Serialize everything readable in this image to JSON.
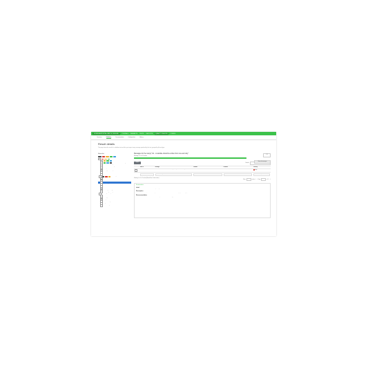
{
  "nav": {
    "brand": "OPENDATAPORTAL-WATCH / ENGINE",
    "items": [
      "PORTALS",
      "DATASETS",
      "TESTS",
      "REPORTS",
      "QUALITY CHECKS",
      "CONFIG"
    ]
  },
  "tabs": [
    "Overview",
    "Validation",
    "Documentation",
    "Configuration",
    "History"
  ],
  "page": {
    "title": "Result details",
    "description": "This page shows the result of a validation test and lets you inspect every message produced by the test, grouped by file and type."
  },
  "left": {
    "title": "Show list"
  },
  "tree": [
    {
      "label": "00 Validation"
    },
    {
      "label": "01 Dataset structure"
    },
    {
      "label": "02 File A - columns missing"
    },
    {
      "label": "03 File B - encoding error"
    },
    {
      "label": "04 Values outside range"
    },
    {
      "label": "05 Duplicated identifiers"
    },
    {
      "label": "06 Empty mandatory fields"
    },
    {
      "label": "07 Dates not ISO formatted"
    },
    {
      "label": "08 Other"
    },
    {
      "label": "09 Messages"
    },
    {
      "label": "10 Unknown codes"
    },
    {
      "label": "11 Inconsistent totals"
    },
    {
      "label": "12 Selected check result"
    },
    {
      "label": "13 Missing licence"
    },
    {
      "label": "14 Schema not found"
    },
    {
      "label": "15 URL not reachable"
    },
    {
      "label": "16 Wrong MIME type"
    },
    {
      "label": "17 Invalid geometry"
    },
    {
      "label": "18 Trailing whitespace"
    },
    {
      "label": "19 Header mismatch"
    },
    {
      "label": "20 Empty rows"
    },
    {
      "label": "21 Byte order mark"
    },
    {
      "label": "22 Line endings"
    },
    {
      "label": "23 Quoted values"
    },
    {
      "label": "24 Summary"
    }
  ],
  "messages": {
    "title": "Messages for the rule(s) \"G1 - A variable should be written from one and only\"",
    "stepper": "1 / 3",
    "meta": "Showing 1 to 1 of 1 entries",
    "progress_label": "100%",
    "progress_value": 1.0,
    "all_button": "Show all messages",
    "add_button": "Export",
    "search_label": "Search:",
    "columns": [
      "",
      "Row ID",
      "Message",
      "Variable",
      "Location",
      "Severity"
    ],
    "filters": [
      "",
      "Search Row ID",
      "Search Message",
      "Search Variable",
      "Search Location",
      "Search Severity"
    ],
    "rows": [
      {
        "check": "",
        "id": "1",
        "message": "Variable name is written in different ways: 'temperature' and 'Temperature' found",
        "variable": "A1",
        "location": "file.csv, line 1, col 1",
        "severity": "High"
      }
    ],
    "pager_info": "Showing 1 to 1 of 1 entries (filtered from 1 total entries)",
    "pager_show": "Show",
    "pager_entries": "entries",
    "pager_page": "Page",
    "pager_of": "of 1"
  },
  "detail": {
    "tab": "Documentation",
    "sections": [
      {
        "title": "Label",
        "text": "A variable should be written from one and only one way."
      },
      {
        "title": "Description",
        "text": "The variable should be spelled the same way across all files and sheets of the dataset to avoid ambiguity when merging."
      },
      {
        "title": "Recommendation",
        "text": "Harmonise the variable names across the dataset and update the metadata accordingly."
      }
    ]
  },
  "colors": {
    "accent": "#3cc24a",
    "selected": "#3077d1",
    "error": "#d9362b"
  }
}
